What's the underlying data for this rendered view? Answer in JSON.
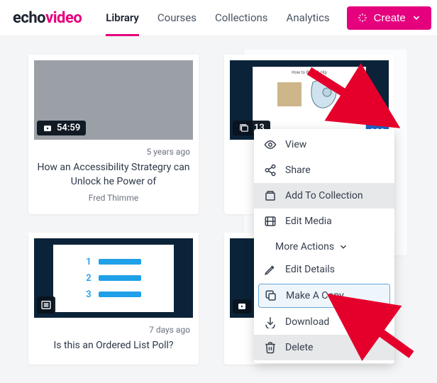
{
  "logo": {
    "part1": "echo",
    "part2": "video"
  },
  "nav": {
    "library": "Library",
    "courses": "Courses",
    "collections": "Collections",
    "analytics": "Analytics"
  },
  "create_label": "Create",
  "cards": {
    "c1": {
      "duration": "54:59",
      "age": "5 years ago",
      "title": "How an Accessibility Strategry can Unlock he Power of",
      "author": "Fred Thimme"
    },
    "c2": {
      "count": "13",
      "slide_title": "How to Build A Hip"
    },
    "c3": {
      "age": "7 days ago",
      "title": "Is this an Ordered List Poll?",
      "opts": {
        "a": "1",
        "b": "2",
        "c": "3"
      }
    }
  },
  "menu": {
    "view": "View",
    "share": "Share",
    "add_collection": "Add To Collection",
    "edit_media": "Edit Media",
    "more_actions": "More Actions",
    "edit_details": "Edit Details",
    "make_copy": "Make A Copy",
    "download": "Download",
    "delete": "Delete"
  }
}
